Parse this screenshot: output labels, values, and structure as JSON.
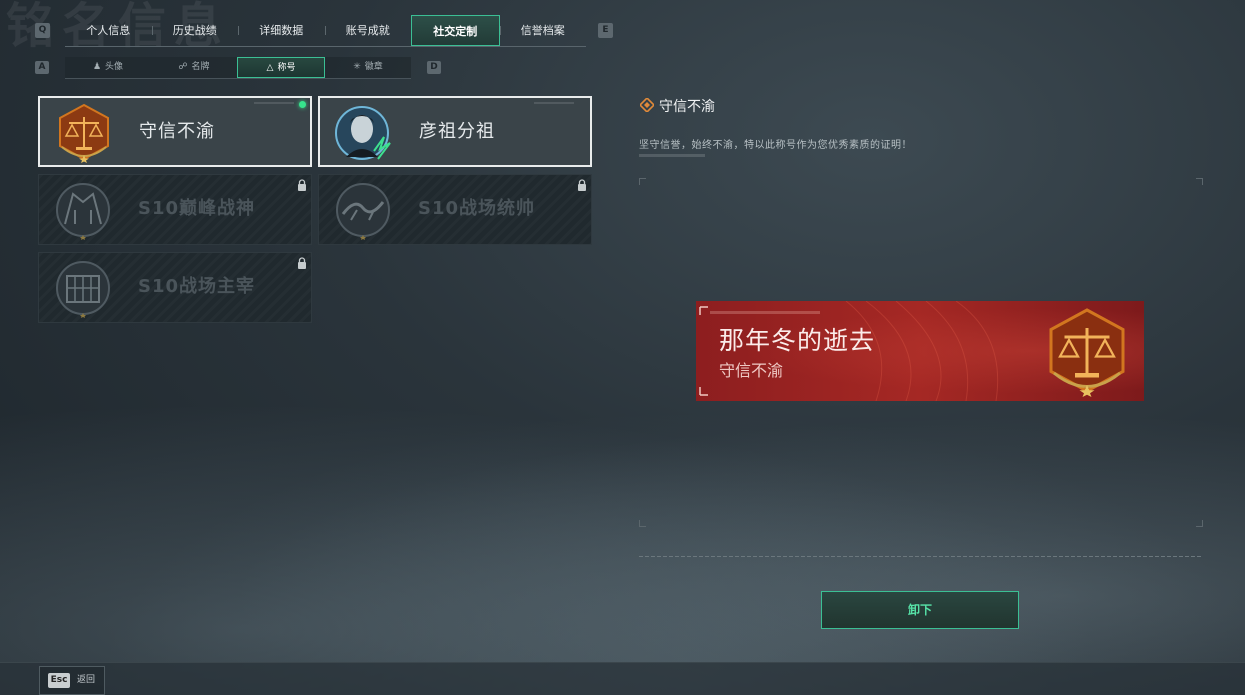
{
  "background_title": "铭名信息",
  "keys": {
    "prev_tab": "Q",
    "next_tab": "E",
    "prev_sub": "A",
    "next_sub": "D"
  },
  "tabs": [
    {
      "label": "个人信息",
      "active": false
    },
    {
      "label": "历史战绩",
      "active": false
    },
    {
      "label": "详细数据",
      "active": false
    },
    {
      "label": "账号成就",
      "active": false
    },
    {
      "label": "社交定制",
      "active": true
    },
    {
      "label": "信誉档案",
      "active": false
    }
  ],
  "subtabs": [
    {
      "label": "头像",
      "icon": "person-icon",
      "active": false
    },
    {
      "label": "名牌",
      "icon": "nameplate-icon",
      "active": false
    },
    {
      "label": "称号",
      "icon": "triangle-icon",
      "active": true
    },
    {
      "label": "徽章",
      "icon": "badge-icon",
      "active": false
    }
  ],
  "titles": [
    {
      "name": "守信不渝",
      "emblem": "scales-emblem",
      "locked": false,
      "equipped": true
    },
    {
      "name": "彦祖分祖",
      "emblem": "portrait-emblem",
      "locked": false,
      "equipped": false
    },
    {
      "name": "S10巅峰战神",
      "emblem": "temple-emblem",
      "locked": true,
      "equipped": false
    },
    {
      "name": "S10战场统帅",
      "emblem": "dragon-emblem",
      "locked": true,
      "equipped": false
    },
    {
      "name": "S10战场主宰",
      "emblem": "colosseum-emblem",
      "locked": true,
      "equipped": false
    }
  ],
  "detail": {
    "name": "守信不渝",
    "description": "坚守信誉，始终不渝，特以此称号作为您优秀素质的证明！"
  },
  "preview": {
    "player_name": "那年冬的逝去",
    "title": "守信不渝"
  },
  "actions": {
    "unequip": "卸下",
    "back": "返回",
    "back_key": "Esc"
  },
  "colors": {
    "accent": "#3bbf94",
    "equipped_dot": "#37e38d",
    "banner_red": "#a52824",
    "emblem_orange": "#d2761f"
  }
}
